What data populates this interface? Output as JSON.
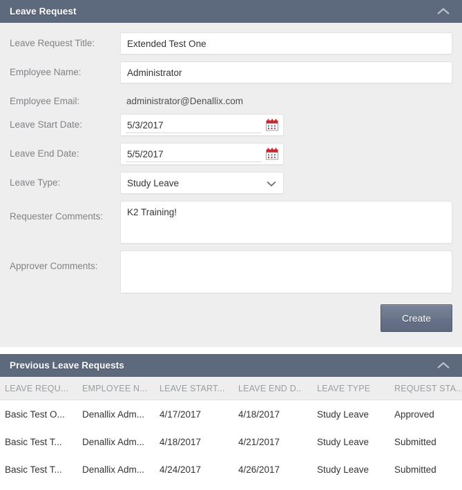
{
  "leave_request_panel": {
    "title": "Leave Request",
    "collapse_icon": "chevron-up-icon",
    "fields": {
      "title_label": "Leave Request Title:",
      "title_value": "Extended Test One",
      "employee_name_label": "Employee Name:",
      "employee_name_value": "Administrator",
      "employee_email_label": "Employee Email:",
      "employee_email_value": "administrator@Denallix.com",
      "start_date_label": "Leave Start Date:",
      "start_date_value": "5/3/2017",
      "end_date_label": "Leave End Date:",
      "end_date_value": "5/5/2017",
      "leave_type_label": "Leave Type:",
      "leave_type_value": "Study Leave",
      "requester_comments_label": "Requester Comments:",
      "requester_comments_value": "K2 Training!",
      "approver_comments_label": "Approver Comments:",
      "approver_comments_value": ""
    },
    "calendar_icon": "calendar-icon",
    "dropdown_icon": "chevron-down-icon",
    "create_button": "Create"
  },
  "previous_panel": {
    "title": "Previous Leave Requests",
    "collapse_icon": "chevron-up-icon",
    "columns": [
      "LEAVE REQU...",
      "EMPLOYEE N...",
      "LEAVE START...",
      "LEAVE END D..",
      "LEAVE TYPE",
      "REQUEST STA.."
    ],
    "rows": [
      {
        "request_title": "Basic Test O...",
        "employee_name": "Denallix Adm...",
        "start_date": "4/17/2017",
        "end_date": "4/18/2017",
        "leave_type": "Study Leave",
        "status": "Approved"
      },
      {
        "request_title": "Basic Test T...",
        "employee_name": "Denallix Adm...",
        "start_date": "4/18/2017",
        "end_date": "4/21/2017",
        "leave_type": "Study Leave",
        "status": "Submitted"
      },
      {
        "request_title": "Basic Test T...",
        "employee_name": "Denallix Adm...",
        "start_date": "4/24/2017",
        "end_date": "4/26/2017",
        "leave_type": "Study Leave",
        "status": "Submitted"
      }
    ]
  },
  "colors": {
    "header_bar": "#5d6a7d",
    "panel_bg": "#eeeeee",
    "label_text": "#808285",
    "calendar_red": "#cc2229",
    "button_gradient_top": "#79839a",
    "button_gradient_bottom": "#5f6a7e"
  }
}
